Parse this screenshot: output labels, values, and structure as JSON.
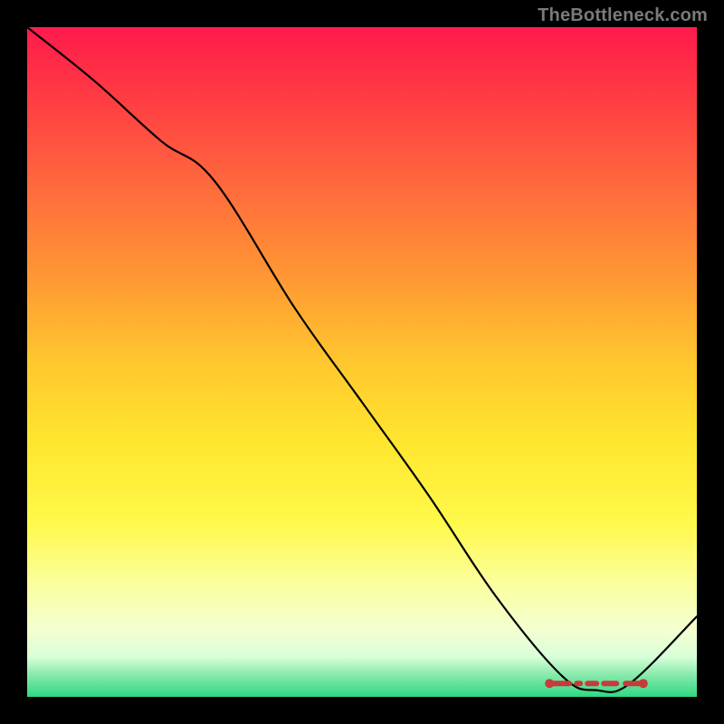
{
  "watermark": "TheBottleneck.com",
  "colors": {
    "curve": "#000000",
    "marker": "#c63b3b"
  },
  "chart_data": {
    "type": "line",
    "title": "",
    "xlabel": "",
    "ylabel": "",
    "xlim": [
      0,
      100
    ],
    "ylim": [
      0,
      100
    ],
    "grid": false,
    "series": [
      {
        "name": "curve",
        "x": [
          0,
          10,
          20,
          28,
          40,
          50,
          60,
          70,
          80,
          85,
          90,
          100
        ],
        "y": [
          100,
          92,
          83,
          77,
          58,
          44,
          30,
          15,
          3,
          1,
          2,
          12
        ]
      }
    ],
    "annotations": {
      "valley_marker": {
        "x_start": 78,
        "x_end": 92,
        "y": 2
      }
    }
  }
}
